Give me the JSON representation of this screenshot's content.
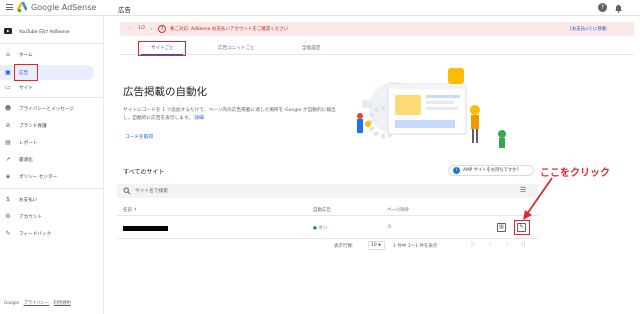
{
  "app": {
    "brand": "Google AdSense",
    "page_title": "広告"
  },
  "sidebar": {
    "account": "YouTube 向け AdSense",
    "items": [
      {
        "label": "ホーム"
      },
      {
        "label": "広告"
      },
      {
        "label": "サイト"
      },
      {
        "label": "プライバシーとメッセージ"
      },
      {
        "label": "ブランド保護"
      },
      {
        "label": "レポート"
      },
      {
        "label": "最適化"
      },
      {
        "label": "ポリシー センター"
      },
      {
        "label": "お支払い"
      },
      {
        "label": "アカウント"
      },
      {
        "label": "フィードバック"
      }
    ],
    "footer": {
      "google": "Google",
      "privacy": "プライバシー",
      "terms": "利用規約"
    }
  },
  "banner": {
    "pager": "1/2",
    "message": "要ご対応: AdSense お支払いアカウントをご確認ください",
    "action": "[お支払い] に移動"
  },
  "tabs": [
    "サイトごと",
    "広告ユニットごと",
    "全般設定"
  ],
  "hero": {
    "title": "広告掲載の自動化",
    "description": "サイトにコードを 1 つ追加するだけで、ページ内の広告掲載に適した場所を Google が自動的に検出し、自動的に広告を表示します。",
    "learn_more": "詳細",
    "get_code": "コードを取得"
  },
  "sites": {
    "title": "すべてのサイト",
    "amp_button": "AMP サイトをお持ちですか？",
    "search_placeholder": "サイト名で検索",
    "columns": {
      "name": "名前",
      "auto_ads": "自動広告",
      "page_exclusions": "ページ除外"
    },
    "rows": [
      {
        "status": "オン",
        "exclusions": "0"
      }
    ],
    "pagination": {
      "rows_label": "表示行数:",
      "rows_value": "10",
      "range": "1 件中 1〜1 件を表示"
    }
  },
  "annotation": {
    "text": "ここをクリック"
  },
  "colors": {
    "accent": "#1a56d6",
    "red": "#e3262a",
    "green": "#1e8e3e",
    "banner_bg": "#fbe9e7"
  }
}
